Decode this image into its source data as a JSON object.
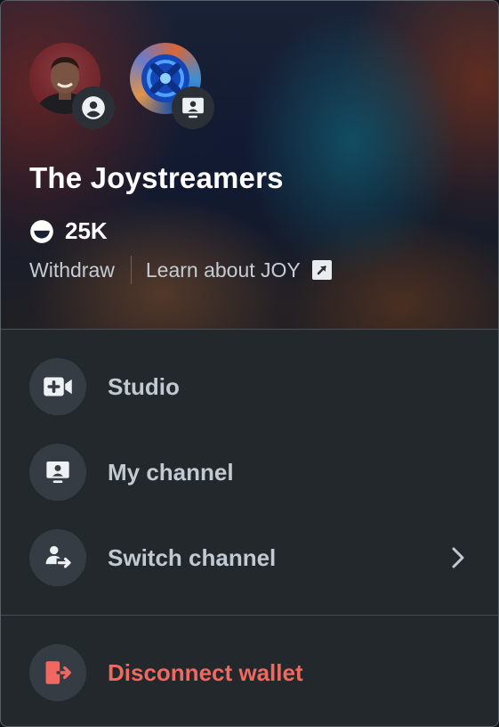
{
  "header": {
    "channel_name": "The Joystreamers",
    "balance": "25K",
    "withdraw_label": "Withdraw",
    "learn_label": "Learn about JOY"
  },
  "menu": {
    "items": [
      {
        "label": "Studio",
        "icon": "video-plus-icon"
      },
      {
        "label": "My channel",
        "icon": "channel-icon"
      },
      {
        "label": "Switch channel",
        "icon": "switch-user-icon"
      }
    ],
    "disconnect_label": "Disconnect wallet"
  },
  "colors": {
    "accent_danger": "#f0685f",
    "panel": "#23282d",
    "icon_circle": "#363c43"
  }
}
